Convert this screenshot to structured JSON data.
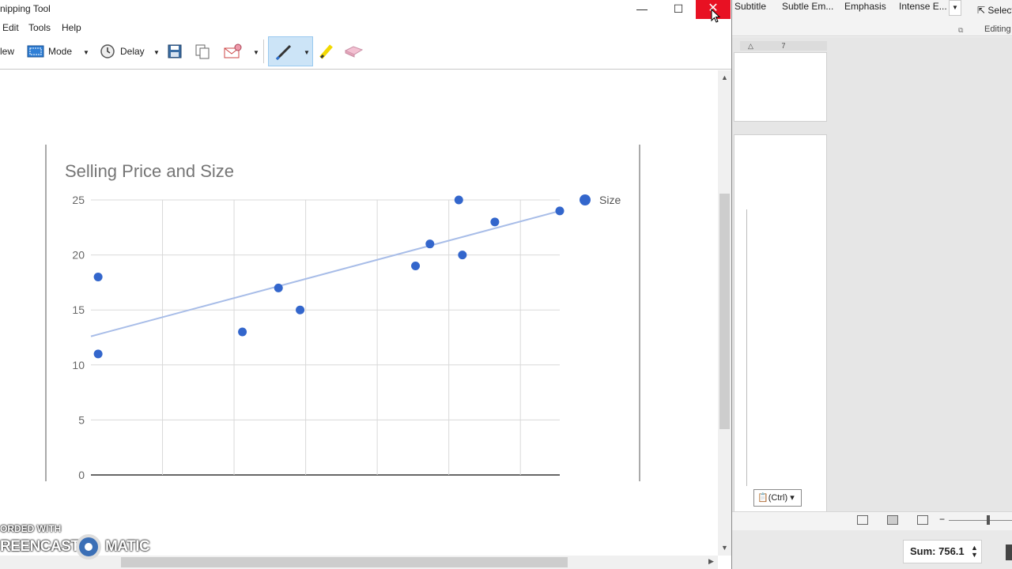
{
  "snipping_tool": {
    "title": "nipping Tool",
    "window_controls": {
      "minimize": "—",
      "maximize": "☐",
      "close": "✕"
    },
    "menu": [
      "Edit",
      "Tools",
      "Help"
    ],
    "toolbar": {
      "new_label": "lew",
      "mode_label": "Mode",
      "delay_label": "Delay"
    },
    "watermark": {
      "line1": "ORDED WITH",
      "line2a": "REENCAST",
      "line2b": "MATIC"
    }
  },
  "chart_data": {
    "type": "scatter",
    "title": "Selling Price and Size",
    "legend": {
      "position": "top-right",
      "entries": [
        "Size"
      ]
    },
    "series": [
      {
        "name": "Size",
        "color": "#3366cc",
        "points": [
          [
            0.1,
            18
          ],
          [
            0.1,
            11
          ],
          [
            2.1,
            13
          ],
          [
            2.6,
            17
          ],
          [
            2.9,
            15
          ],
          [
            4.5,
            19
          ],
          [
            4.7,
            21
          ],
          [
            5.1,
            25
          ],
          [
            5.15,
            20
          ],
          [
            5.6,
            23
          ],
          [
            6.5,
            24
          ]
        ]
      }
    ],
    "trendline": {
      "type": "linear",
      "start": [
        0,
        12.6
      ],
      "end": [
        6.5,
        24
      ]
    },
    "ylim": [
      0,
      25
    ],
    "yticks": [
      "0",
      "5",
      "10",
      "15",
      "20",
      "25"
    ],
    "xlim": [
      0,
      6.5
    ],
    "grid": true
  },
  "word": {
    "styles": [
      "Subtitle",
      "Subtle Em...",
      "Emphasis",
      "Intense E..."
    ],
    "select_label": "Select",
    "editing_label": "Editing",
    "ruler_mark": "7",
    "paste_ctrl": "(Ctrl)",
    "sum_label": "Sum: 756.1"
  }
}
